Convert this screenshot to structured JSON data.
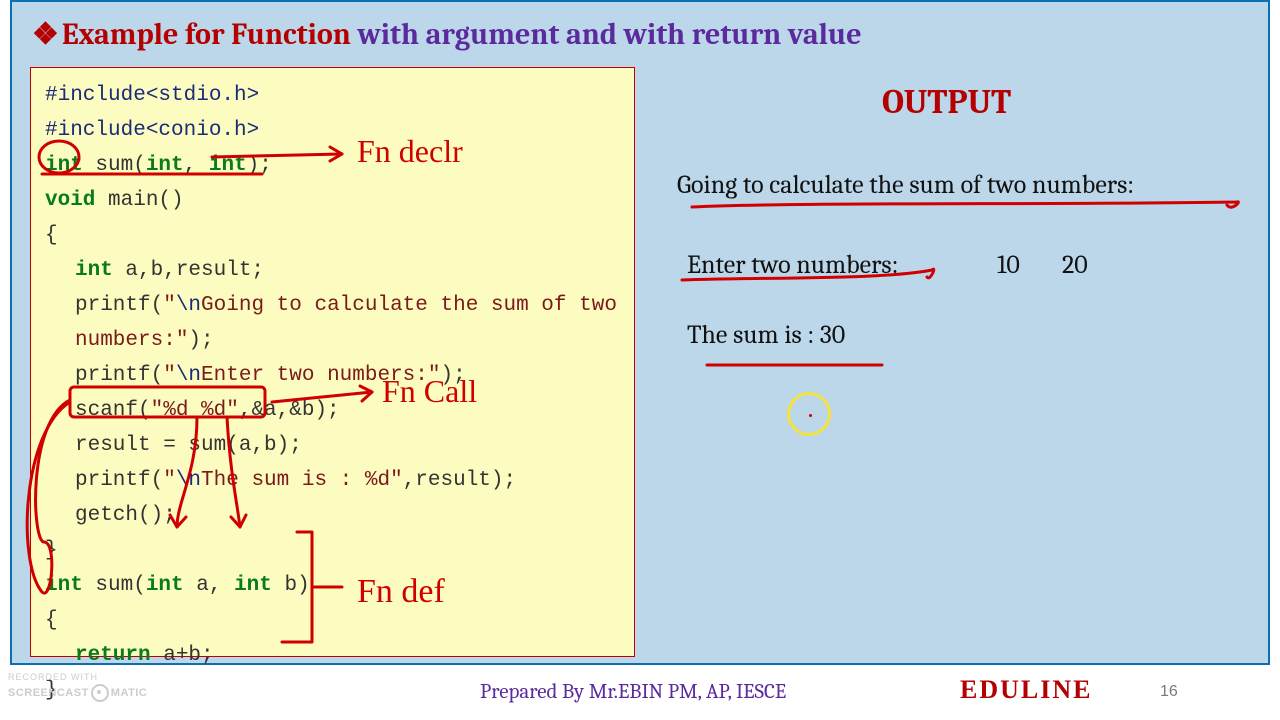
{
  "title": {
    "part1": "Example for Function ",
    "part2": "with argument and with return value"
  },
  "code": {
    "l1a": "#include<stdio.h>",
    "l2a": "#include<conio.h>",
    "l3_int": "int",
    "l3_rest": " sum(",
    "l3_int2": "int",
    "l3_c": ", ",
    "l3_int3": "int",
    "l3_end": ");",
    "l4_void": "void",
    "l4_main": " main()",
    "l5": "{",
    "l6_int": "int",
    "l6_rest": " a,b,result;",
    "l7a": "printf(",
    "l7s": "\"",
    "l7esc": "\\n",
    "l7txt": "Going to calculate the sum of two numbers:\"",
    "l7e": ");",
    "l8a": "printf(",
    "l8s": "\"",
    "l8esc": "\\n",
    "l8txt": "Enter two numbers:\"",
    "l8e": ");",
    "l9a": "scanf(",
    "l9s": "\"%d %d\"",
    "l9e": ",&a,&b);",
    "l10": "result = sum(a,b);",
    "l11a": "printf(",
    "l11s": "\"",
    "l11esc": "\\n",
    "l11txt": "The sum is : %d\"",
    "l11e": ",result);",
    "l12": "getch();",
    "l13": "}",
    "l14_int": "int",
    "l14_a": " sum(",
    "l14_int2": "int",
    "l14_b": " a, ",
    "l14_int3": "int",
    "l14_c": " b)",
    "l15": "{",
    "l16_ret": "return",
    "l16_rest": " a+b;",
    "l17": "}"
  },
  "annotations": {
    "fn_declr": "Fn declr",
    "fn_call": "Fn Call",
    "fn_def": "Fn def"
  },
  "output": {
    "head": "OUTPUT",
    "l1": "Going to calculate the sum of two numbers:",
    "l2a": "Enter two numbers:",
    "l2b": "10",
    "l2c": "20",
    "l3": "The sum is : 30"
  },
  "footer": {
    "prepared": "Prepared By Mr.EBIN PM, AP, IESCE",
    "brand": "EDULINE",
    "page": "16",
    "wm1": "RECORDED WITH",
    "wm2a": "SCREENCAST",
    "wm2b": "MATIC"
  }
}
